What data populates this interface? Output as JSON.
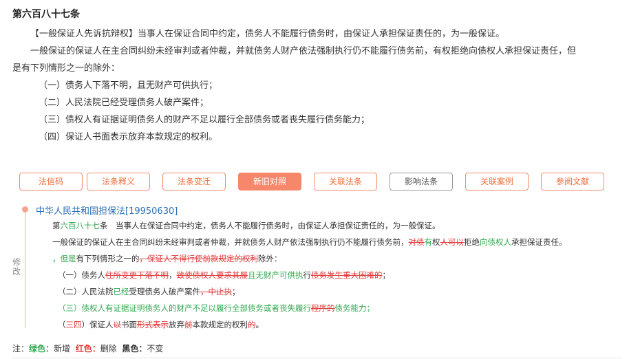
{
  "article": {
    "title": "第六百八十七条",
    "p1": "【一般保证人先诉抗辩权】当事人在保证合同中约定，债务人不能履行债务时，由保证人承担保证责任的，为一般保证。",
    "p2": "一般保证的保证人在主合同纠纷未经审判或者仲裁，并就债务人财产依法强制执行仍不能履行债务前，有权拒绝向债权人承担保证责任，但",
    "p2b": "是有下列情形之一的除外：",
    "items": [
      "（一）债务人下落不明，且无财产可供执行；",
      "（二）人民法院已经受理债务人破产案件；",
      "（三）债权人有证据证明债务人的财产不足以履行全部债务或者丧失履行债务能力；",
      "（四）保证人书面表示放弃本款规定的权利。"
    ]
  },
  "tabs": [
    "法信码",
    "法条释义",
    "法条变迁",
    "新旧对照",
    "关联法条",
    "影响法条",
    "关联案例",
    "参阅文献"
  ],
  "active_tab": "新旧对照",
  "compare": {
    "side_label": "修改",
    "law_title": "中华人民共和国担保法[19950630]",
    "l1": [
      "第",
      "六百八十七",
      "条　当事人在保证合同中约定，债务人不能履行债务时，由保证人承担保证责任的，为一般保证。"
    ],
    "l2": [
      "一般保证的保证人在主合同纠纷未经审判或者仲裁，并就债务人财产依法强制执行仍不能履行债务前，",
      "对债",
      "有",
      "权",
      "人可以",
      "拒绝",
      "向债权人",
      "承担保证责任。"
    ],
    "l3": [
      "，但是",
      "有下列情形之一的",
      "，保证人不得行使前款规定的权利",
      "除外："
    ],
    "l4": [
      "（一）债务人",
      "住所变更下落不明",
      "，",
      "致使债权人要求其履",
      "且无财产可供执",
      "行",
      "债务发生重大困难的",
      "；"
    ],
    "l5": [
      "（二）人民法院",
      "已经",
      "受理债务人破产案件",
      "，中止执",
      "；"
    ],
    "l6": [
      "（三）债权人有证据证明债务人的财产不足以履行全部债务或者丧失履行",
      "程序的",
      "债务能力",
      "；"
    ],
    "l7": [
      "（",
      "三四",
      "）保证人",
      "以",
      "书面",
      "形式表示",
      "放弃",
      "前",
      "本款规定的权利",
      "的",
      "。"
    ]
  },
  "note": {
    "prefix": "注：",
    "green_label": "绿色：",
    "green_text": "新增",
    "red_label": "红色：",
    "red_text": "删除",
    "black_label": "黑色：",
    "black_text": "不变"
  },
  "colors": {
    "accent": "#f7876a",
    "added": "#2fa84f",
    "deleted": "#e03c3c",
    "link": "#2a6db3"
  }
}
